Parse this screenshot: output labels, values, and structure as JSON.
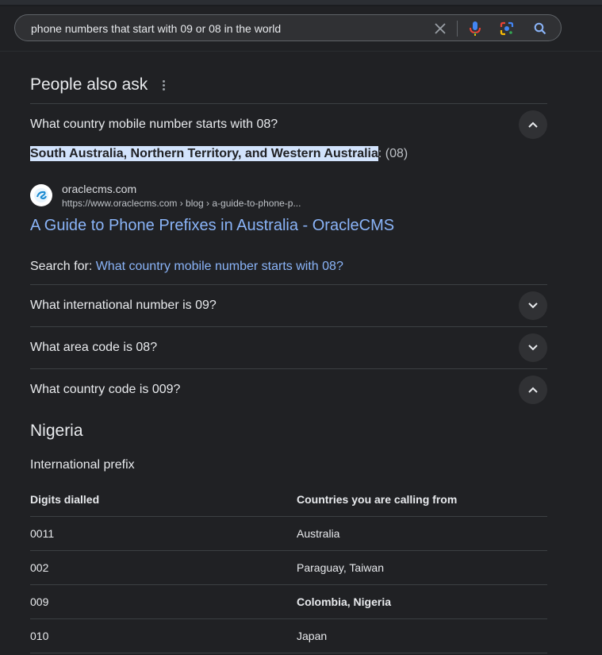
{
  "search": {
    "query": "phone numbers that start with 09 or 08 in the world"
  },
  "paa": {
    "title": "People also ask",
    "questions": [
      {
        "text": "What country mobile number starts with 08?",
        "expanded": true
      },
      {
        "text": "What international number is 09?",
        "expanded": false
      },
      {
        "text": "What area code is 08?",
        "expanded": false
      },
      {
        "text": "What country code is 009?",
        "expanded": true
      }
    ],
    "answer1": {
      "highlight": "South Australia, Northern Territory, and Western Australia",
      "rest": ": (08)",
      "site_name": "oraclecms.com",
      "site_url": "https://www.oraclecms.com › blog › a-guide-to-phone-p...",
      "result_title": "A Guide to Phone Prefixes in Australia - OracleCMS",
      "search_for_label": "Search for: ",
      "search_for_link": "What country mobile number starts with 08?"
    },
    "answer4": {
      "heading": "Nigeria",
      "subheading": "International prefix",
      "table": {
        "headers": [
          "Digits dialled",
          "Countries you are calling from"
        ],
        "rows": [
          [
            "0011",
            "Australia"
          ],
          [
            "002",
            "Paraguay, Taiwan"
          ],
          [
            "009",
            "Colombia, Nigeria"
          ],
          [
            "010",
            "Japan"
          ]
        ]
      }
    }
  },
  "colors": {
    "background": "#202124",
    "link": "#8ab4f8",
    "highlight": "#d2e3fc"
  },
  "icons": [
    "close-icon",
    "microphone-icon",
    "google-lens-icon",
    "search-icon",
    "more-vert-icon",
    "chevron-up-icon",
    "chevron-down-icon",
    "oraclecms-favicon"
  ]
}
